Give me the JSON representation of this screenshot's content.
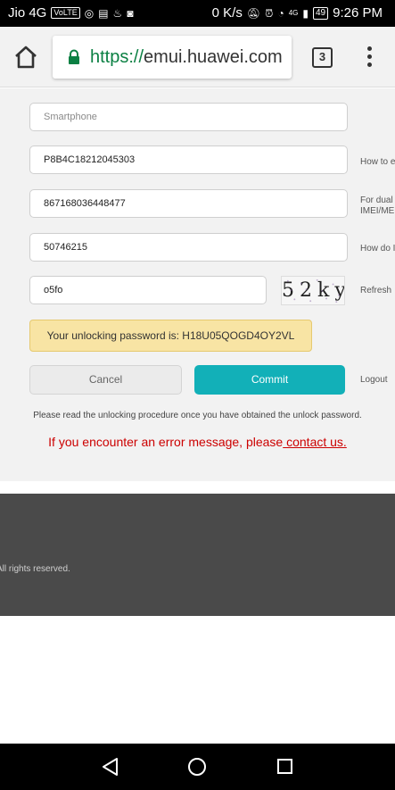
{
  "status_bar": {
    "carrier": "Jio 4G",
    "volte": "VoLTE",
    "net_speed": "0 K/s",
    "signal_label": "4G",
    "battery": "49",
    "time": "9:26 PM"
  },
  "browser": {
    "url_scheme": "https://",
    "url_host": "emui.huawei.com",
    "tab_count": "3"
  },
  "form": {
    "device_type_placeholder": "Smartphone",
    "serial_number": "P8B4C18212045303",
    "serial_hint": "How to e",
    "imei": "867168036448477",
    "imei_hint_line1": "For dual",
    "imei_hint_line2": "IMEI/ME",
    "product_id": "50746215",
    "product_id_hint": "How do I",
    "captcha_input": "o5fo",
    "captcha_text": "52ky",
    "refresh_label": "Refresh",
    "unlock_notice": "Your unlocking password is: H18U05QOGD4OY2VL",
    "cancel_label": "Cancel",
    "commit_label": "Commit",
    "logout_label": "Logout",
    "procedure_text": "Please read the unlocking procedure once you have obtained the unlock password.",
    "error_text": "If you encounter an error message, please",
    "contact_link": " contact us."
  },
  "footer": {
    "rights": "All rights reserved."
  },
  "colors": {
    "commit": "#12b0b8",
    "notice_bg": "#f8e4a4",
    "error": "#cc0000",
    "secure": "#0b8043"
  }
}
